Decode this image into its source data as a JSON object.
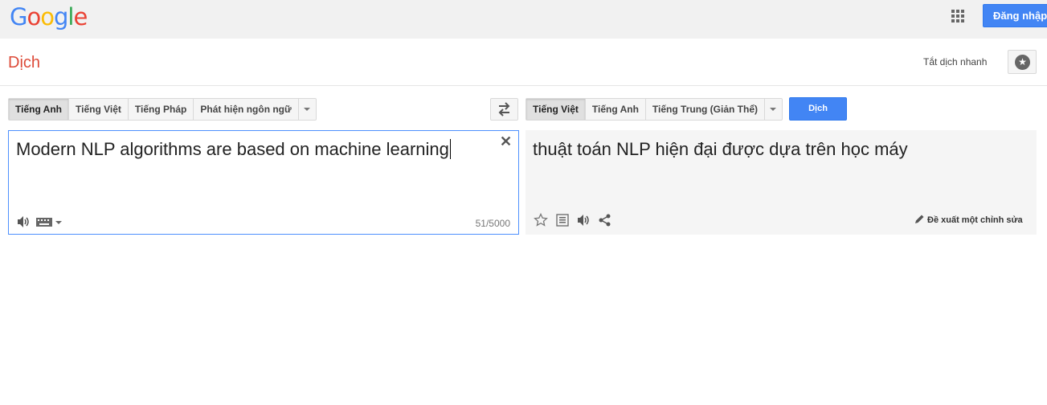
{
  "header": {
    "logo_letters": [
      {
        "ch": "G",
        "color": "#4285f4"
      },
      {
        "ch": "o",
        "color": "#ea4335"
      },
      {
        "ch": "o",
        "color": "#fbbc05"
      },
      {
        "ch": "g",
        "color": "#4285f4"
      },
      {
        "ch": "l",
        "color": "#34a853"
      },
      {
        "ch": "e",
        "color": "#ea4335"
      }
    ],
    "apps_icon": "apps-grid-icon",
    "signin_label": "Đăng nhập",
    "accent_color": "#4285f4"
  },
  "titlebar": {
    "title": "Dịch",
    "instant_label": "Tắt dịch nhanh",
    "star_icon": "star-icon"
  },
  "source_langs": {
    "items": [
      "Tiếng Anh",
      "Tiếng Việt",
      "Tiếng Pháp",
      "Phát hiện ngôn ngữ"
    ],
    "selected": 0
  },
  "swap_icon": "swap-arrows-icon",
  "target_langs": {
    "items": [
      "Tiếng Việt",
      "Tiếng Anh",
      "Tiếng Trung (Giản Thể)"
    ],
    "selected": 0
  },
  "translate_label": "Dịch",
  "source": {
    "text": "Modern NLP algorithms are based on machine learning",
    "clear_icon": "close-icon",
    "char_count": "51/5000"
  },
  "result": {
    "text": "thuật toán NLP hiện đại được dựa trên học máy",
    "suggest_label": "Đề xuất một chỉnh sửa"
  }
}
